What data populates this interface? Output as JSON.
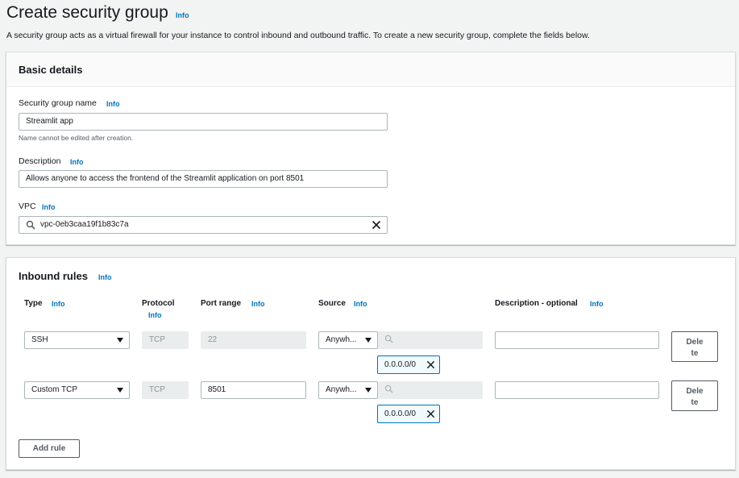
{
  "page": {
    "title": "Create security group",
    "info": "Info",
    "description": "A security group acts as a virtual firewall for your instance to control inbound and outbound traffic. To create a new security group, complete the fields below."
  },
  "basic_details": {
    "title": "Basic details",
    "name_label": "Security group name",
    "name_info": "Info",
    "name_value": "Streamlit app",
    "name_hint": "Name cannot be edited after creation.",
    "desc_label": "Description",
    "desc_info": "Info",
    "desc_value": "Allows anyone to access the frontend of the Streamlit application on port 8501",
    "vpc_label": "VPC",
    "vpc_info": "Info",
    "vpc_value": "vpc-0eb3caa19f1b83c7a"
  },
  "inbound": {
    "title": "Inbound rules",
    "info": "Info",
    "columns": {
      "type": "Type",
      "type_info": "Info",
      "protocol": "Protocol",
      "protocol_info": "Info",
      "port": "Port range",
      "port_info": "Info",
      "source": "Source",
      "source_info": "Info",
      "desc": "Description - optional",
      "desc_info": "Info"
    },
    "rules": [
      {
        "type": "SSH",
        "protocol": "TCP",
        "port": "22",
        "source": "Anywh...",
        "cidr": "0.0.0.0/0",
        "description": "",
        "delete_line1": "Dele",
        "delete_line2": "te"
      },
      {
        "type": "Custom TCP",
        "protocol": "TCP",
        "port": "8501",
        "source": "Anywh...",
        "cidr": "0.0.0.0/0",
        "description": "",
        "delete_line1": "Dele",
        "delete_line2": "te"
      }
    ],
    "add_rule": "Add rule"
  },
  "colors": {
    "link": "#0073bb",
    "border": "#aab7b8",
    "disabled_bg": "#eaeded"
  }
}
